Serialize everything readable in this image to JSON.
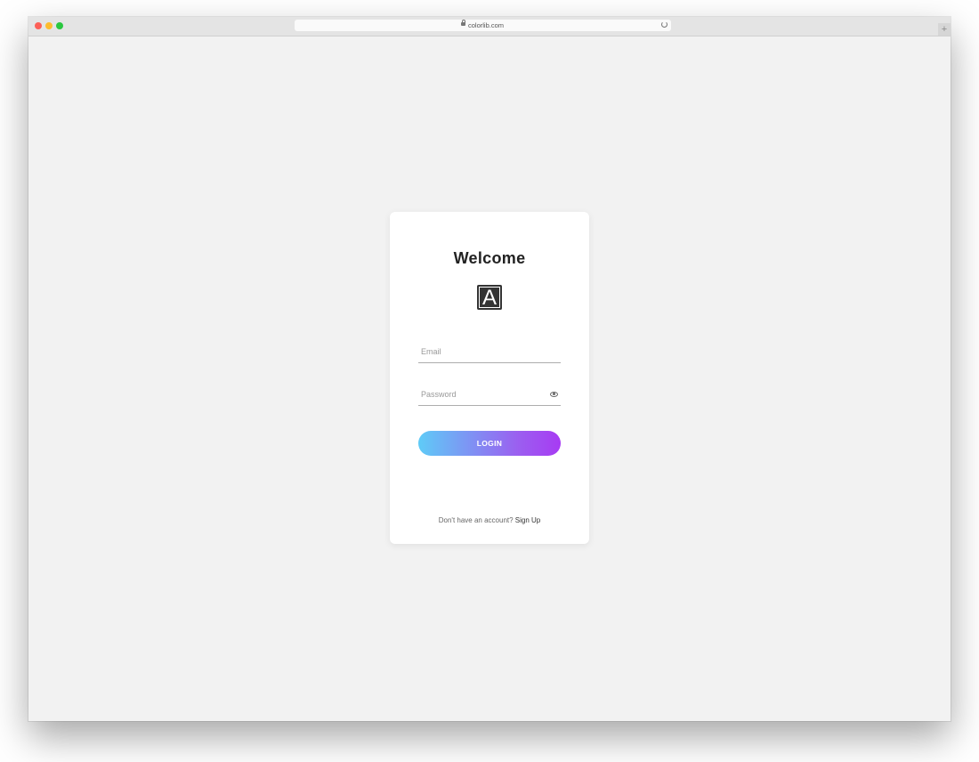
{
  "browser": {
    "url": "colorlib.com",
    "newtab_label": "+"
  },
  "login_card": {
    "title": "Welcome",
    "logo_letter": "A",
    "email_placeholder": "Email",
    "password_placeholder": "Password",
    "login_label": "LOGIN",
    "signup_prompt": "Don't have an account?",
    "signup_link": "Sign Up"
  },
  "colors": {
    "gradient_start": "#5fcbf7",
    "gradient_end": "#a73bf3",
    "page_background": "#f2f2f2"
  }
}
